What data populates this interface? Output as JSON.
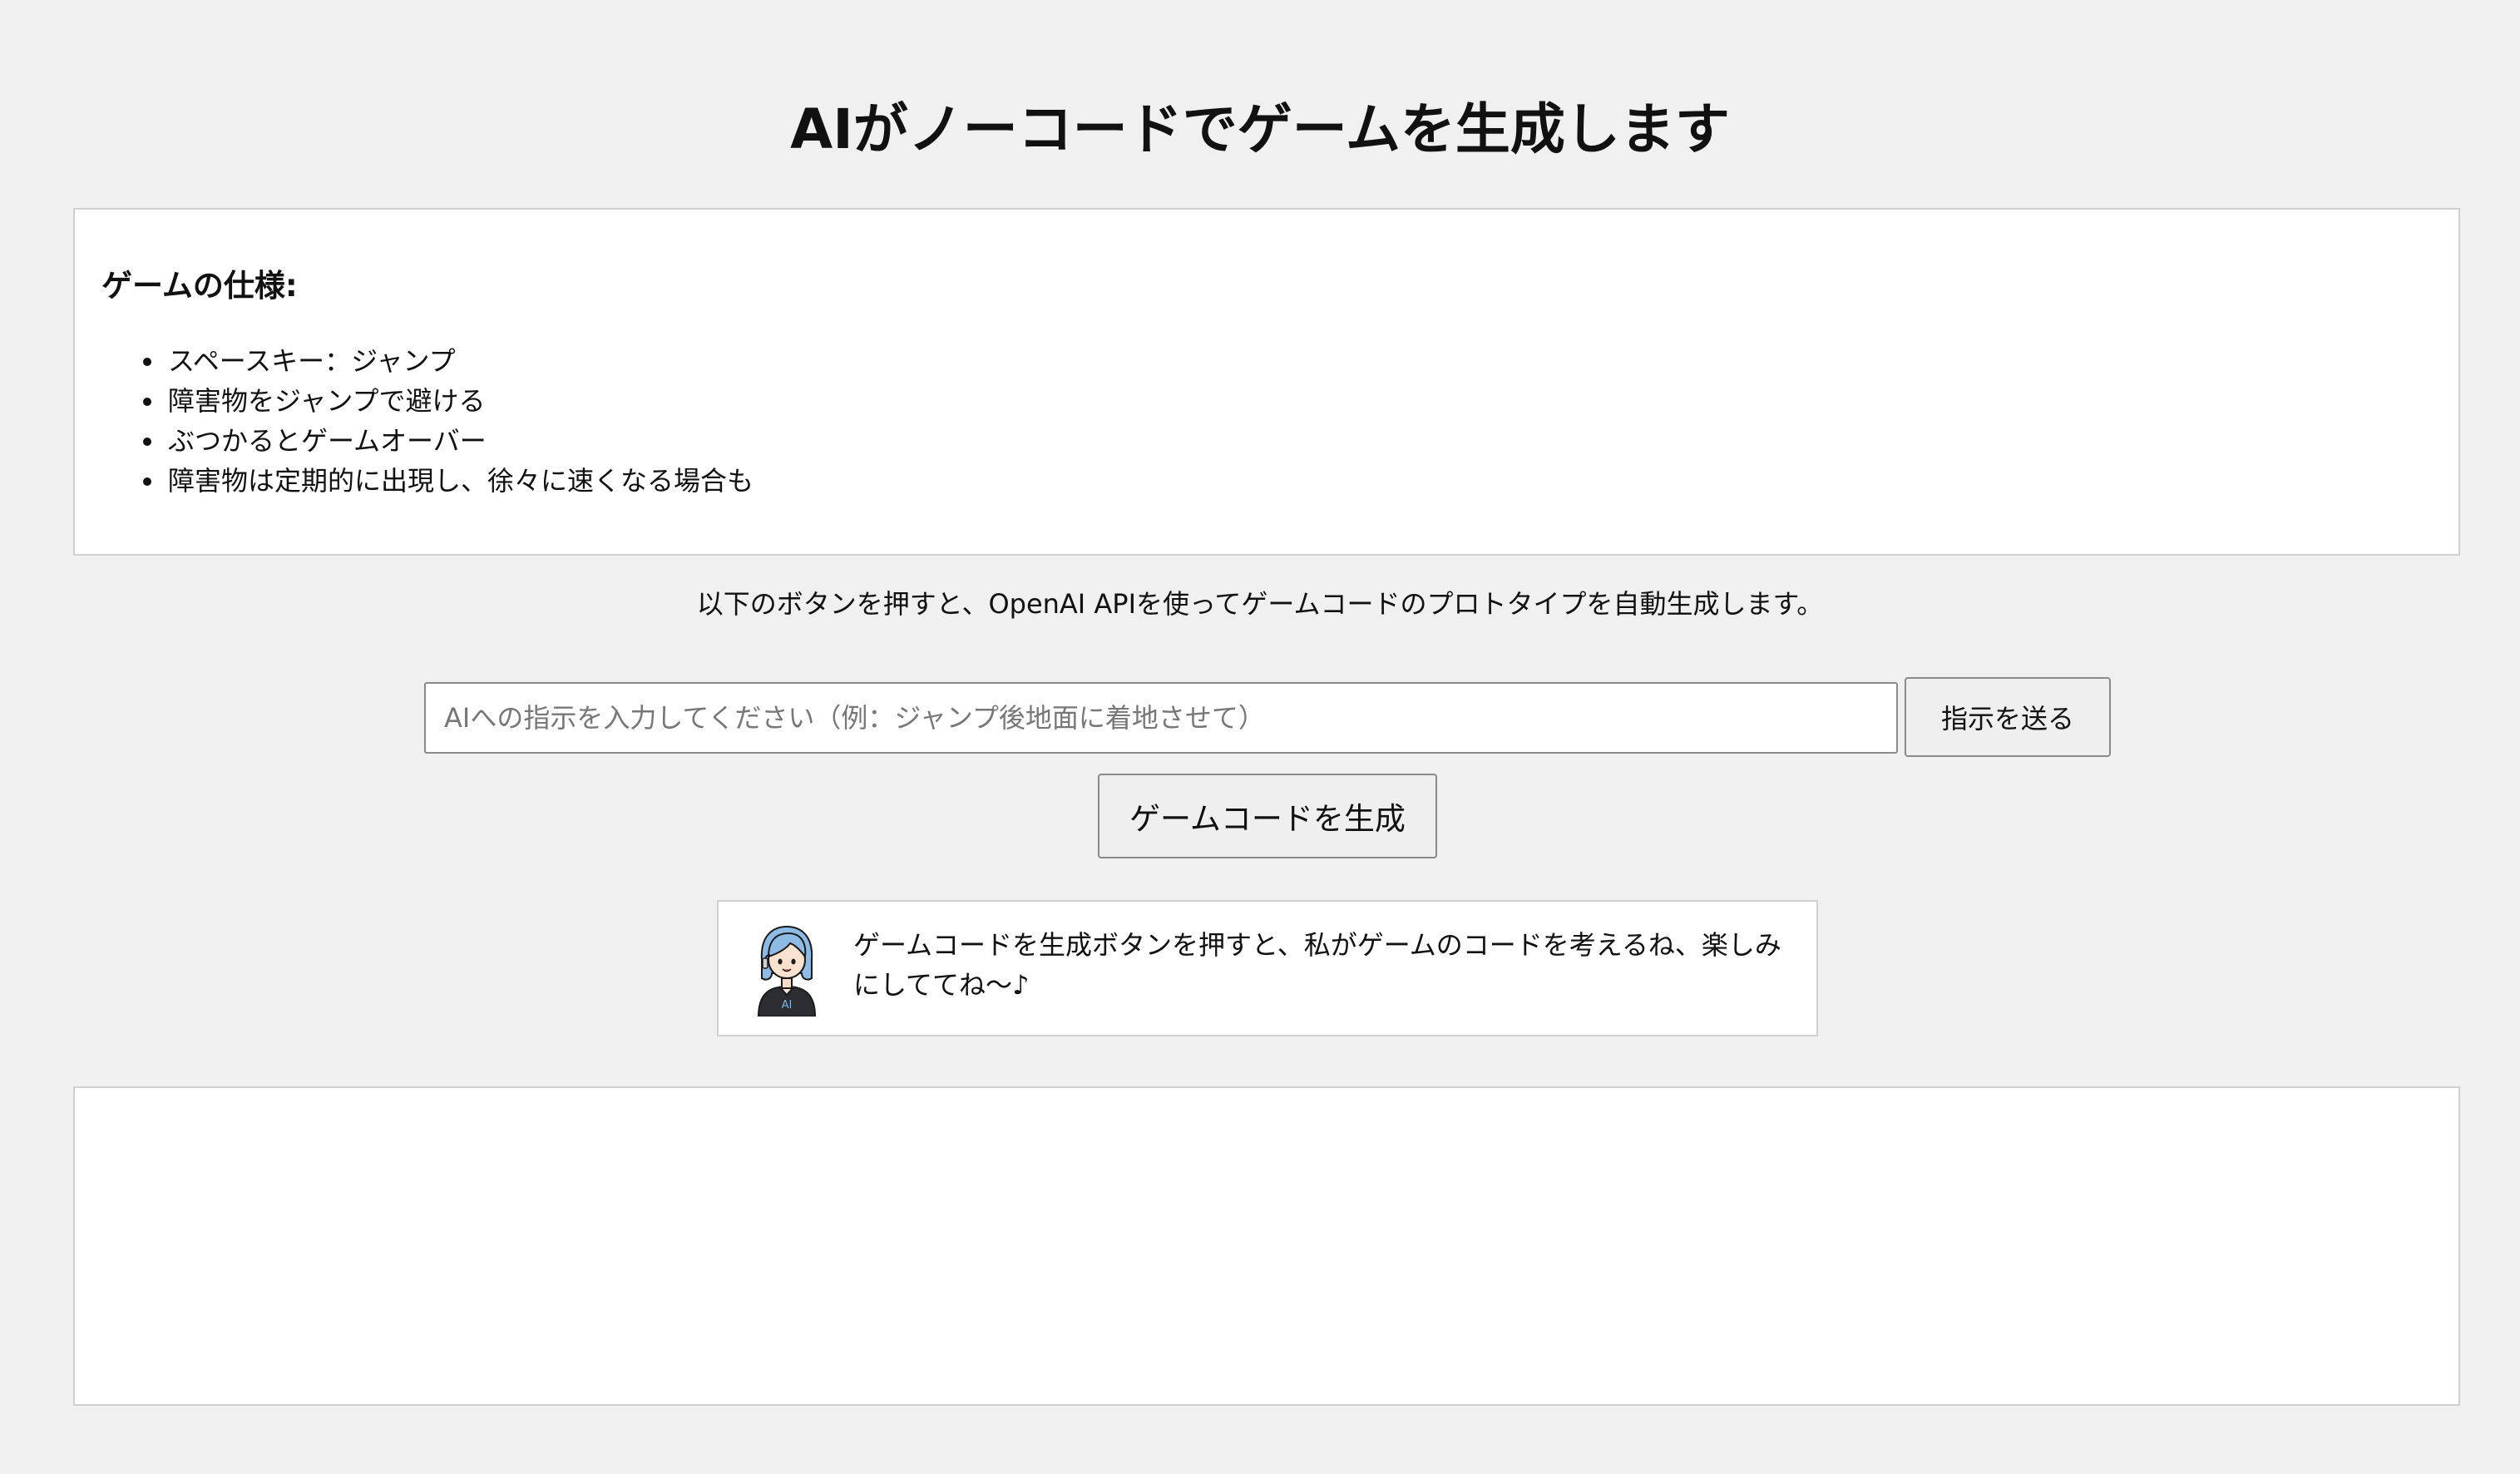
{
  "page": {
    "title": "AIがノーコードでゲームを生成します"
  },
  "spec": {
    "heading": "ゲームの仕様:",
    "items": [
      "スペースキー：ジャンプ",
      "障害物をジャンプで避ける",
      "ぶつかるとゲームオーバー",
      "障害物は定期的に出現し、徐々に速くなる場合も"
    ]
  },
  "intro": {
    "text": "以下のボタンを押すと、OpenAI APIを使ってゲームコードのプロトタイプを自動生成します。"
  },
  "instruction": {
    "value": "",
    "placeholder": "AIへの指示を入力してください（例：ジャンプ後地面に着地させて）",
    "send_label": "指示を送る"
  },
  "generate": {
    "label": "ゲームコードを生成"
  },
  "assistant": {
    "message": "ゲームコードを生成ボタンを押すと、私がゲームのコードを考えるね、楽しみにしててね〜♪",
    "badge": "AI",
    "avatar_icon": "ai-assistant-avatar-icon"
  },
  "output": {
    "content": ""
  },
  "colors": {
    "background": "#f0f0f0",
    "panel": "#ffffff",
    "border": "#d0d0d0",
    "button": "#efefef",
    "avatar_hair": "#8ebbe6",
    "avatar_shirt": "#2b2d31"
  }
}
